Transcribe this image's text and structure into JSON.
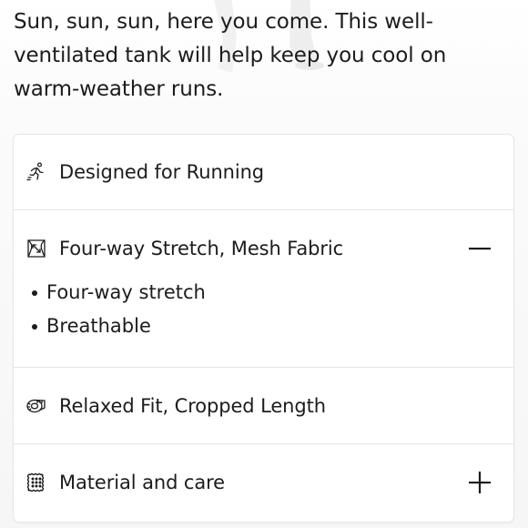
{
  "description": "Sun, sun, sun, here you come. This well-ventilated tank will help keep you cool on warm-weather runs.",
  "accordion": {
    "sections": [
      {
        "title": "Designed for Running",
        "icon": "running-person-icon",
        "expanded": false,
        "toggle": null,
        "items": []
      },
      {
        "title": "Four-way Stretch, Mesh Fabric",
        "icon": "stretch-fabric-icon",
        "expanded": true,
        "toggle": "minus-icon",
        "items": [
          "Four-way stretch",
          "Breathable"
        ]
      },
      {
        "title": "Relaxed Fit, Cropped Length",
        "icon": "tape-measure-icon",
        "expanded": false,
        "toggle": null,
        "items": []
      },
      {
        "title": "Material and care",
        "icon": "fabric-swatch-icon",
        "expanded": false,
        "toggle": "plus-icon",
        "items": []
      }
    ]
  },
  "colors": {
    "text": "#1c1c1c",
    "divider": "#e4e4e4",
    "card_background": "#ffffff",
    "page_background": "#f6f6f6"
  }
}
